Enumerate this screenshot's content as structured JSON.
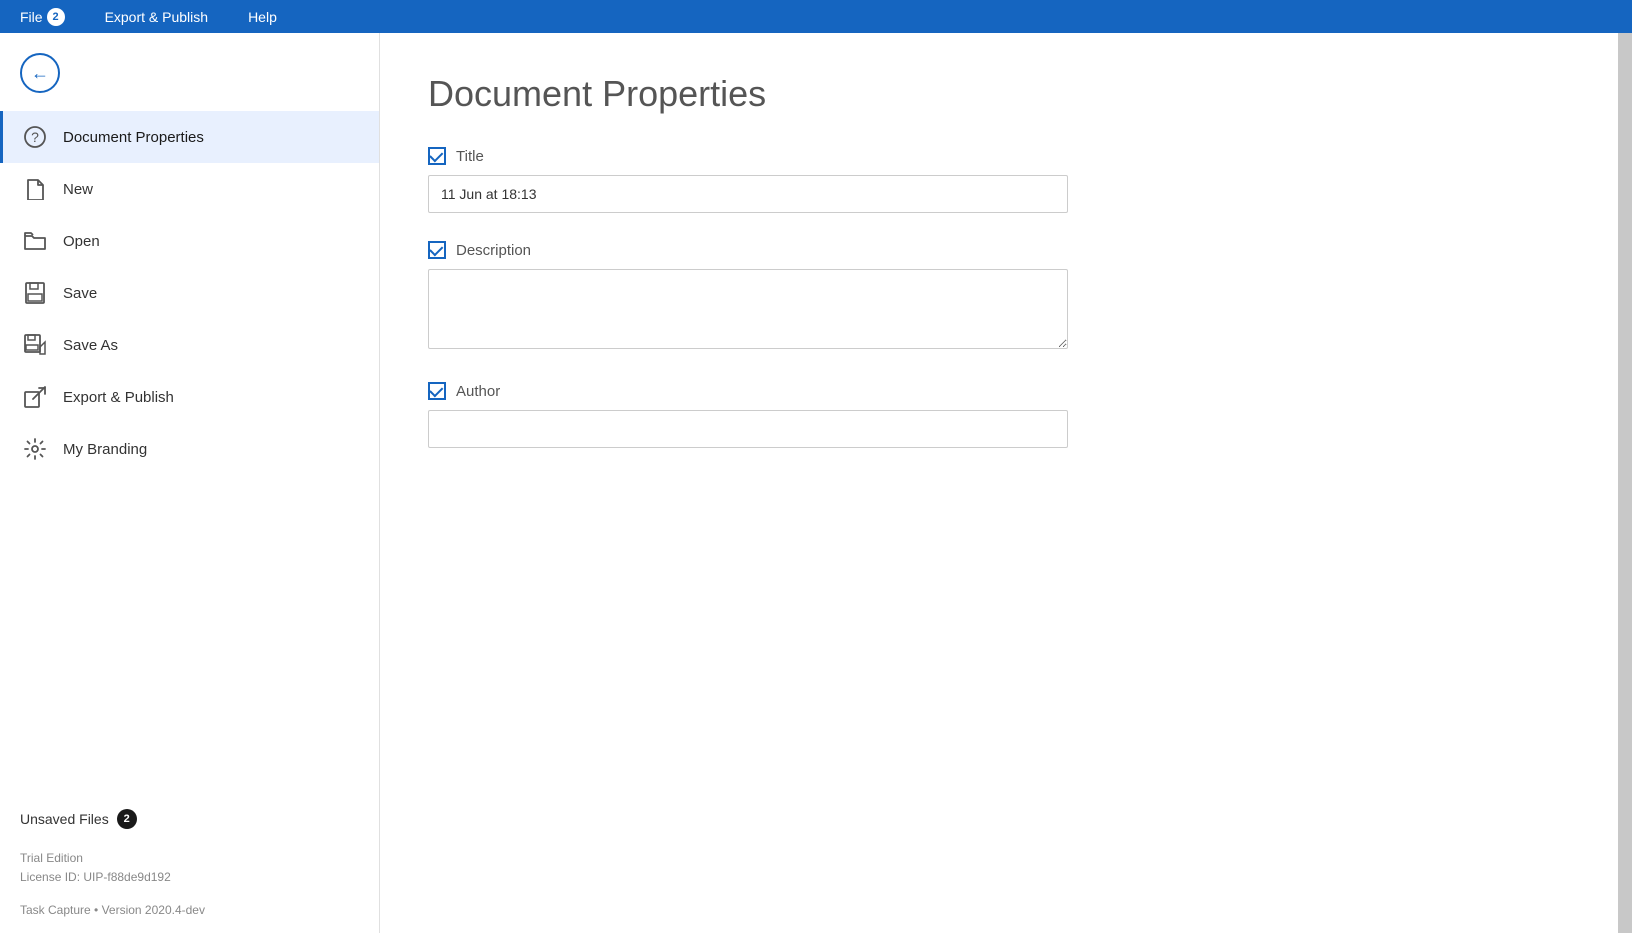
{
  "menubar": {
    "file_label": "File",
    "file_badge": "2",
    "export_publish_label": "Export & Publish",
    "help_label": "Help"
  },
  "sidebar": {
    "nav_items": [
      {
        "id": "document-properties",
        "label": "Document Properties",
        "icon": "❓",
        "active": true
      },
      {
        "id": "new",
        "label": "New",
        "icon": "📄"
      },
      {
        "id": "open",
        "label": "Open",
        "icon": "📂"
      },
      {
        "id": "save",
        "label": "Save",
        "icon": "💾"
      },
      {
        "id": "save-as",
        "label": "Save As",
        "icon": "💾"
      },
      {
        "id": "export-publish",
        "label": "Export & Publish",
        "icon": "📤"
      },
      {
        "id": "my-branding",
        "label": "My Branding",
        "icon": "⚙️"
      }
    ],
    "unsaved_files_label": "Unsaved Files",
    "unsaved_files_count": "2",
    "trial_edition": "Trial Edition",
    "license_id": "License ID: UIP-f88de9d192",
    "app_version": "Task Capture • Version 2020.4-dev"
  },
  "content": {
    "page_title": "Document Properties",
    "fields": [
      {
        "id": "title",
        "label": "Title",
        "checked": true,
        "type": "input",
        "value": "11 Jun at 18:13",
        "placeholder": ""
      },
      {
        "id": "description",
        "label": "Description",
        "checked": true,
        "type": "textarea",
        "value": "",
        "placeholder": ""
      },
      {
        "id": "author",
        "label": "Author",
        "checked": true,
        "type": "input",
        "value": "",
        "placeholder": ""
      }
    ]
  },
  "icons": {
    "back_arrow": "←",
    "document": "📄",
    "folder_open": "📂",
    "save": "💾",
    "save_as": "💾",
    "export": "📤",
    "branding": "⚙️",
    "question": "❓"
  }
}
